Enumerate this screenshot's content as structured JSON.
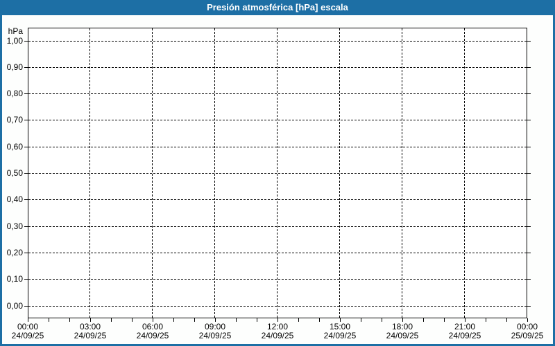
{
  "window": {
    "title": "Presión atmosférica [hPa] escala"
  },
  "theme": {
    "titlebar_bg": "#1d6fa5",
    "titlebar_text": "#ffffff",
    "window_border": "#1d6fa5",
    "window_bg": "#fdfefd",
    "plot_bg": "#ffffff",
    "grid_color": "#000000",
    "axis_color": "#000000",
    "label_color": "#000000"
  },
  "axes": {
    "unit_label": "hPa",
    "y_tick_labels": [
      "1,00",
      "0,90",
      "0,80",
      "0,70",
      "0,60",
      "0,50",
      "0,40",
      "0,30",
      "0,20",
      "0,10",
      "0,00"
    ],
    "x_ticks": [
      {
        "time": "00:00",
        "date": "24/09/25"
      },
      {
        "time": "03:00",
        "date": "24/09/25"
      },
      {
        "time": "06:00",
        "date": "24/09/25"
      },
      {
        "time": "09:00",
        "date": "24/09/25"
      },
      {
        "time": "12:00",
        "date": "24/09/25"
      },
      {
        "time": "15:00",
        "date": "24/09/25"
      },
      {
        "time": "18:00",
        "date": "24/09/25"
      },
      {
        "time": "21:00",
        "date": "24/09/25"
      },
      {
        "time": "00:00",
        "date": "25/09/25"
      }
    ]
  },
  "chart_data": {
    "type": "line",
    "title": "Presión atmosférica [hPa] escala",
    "xlabel": "",
    "ylabel": "hPa",
    "ylim": [
      0.0,
      1.0
    ],
    "y_tick_step": 0.1,
    "x_range_start": "24/09/25 00:00",
    "x_range_end": "25/09/25 00:00",
    "x_major_tick_hours": 3,
    "x_minor_tick_hours": 1,
    "grid": "dashed",
    "legend": "none",
    "series": []
  }
}
